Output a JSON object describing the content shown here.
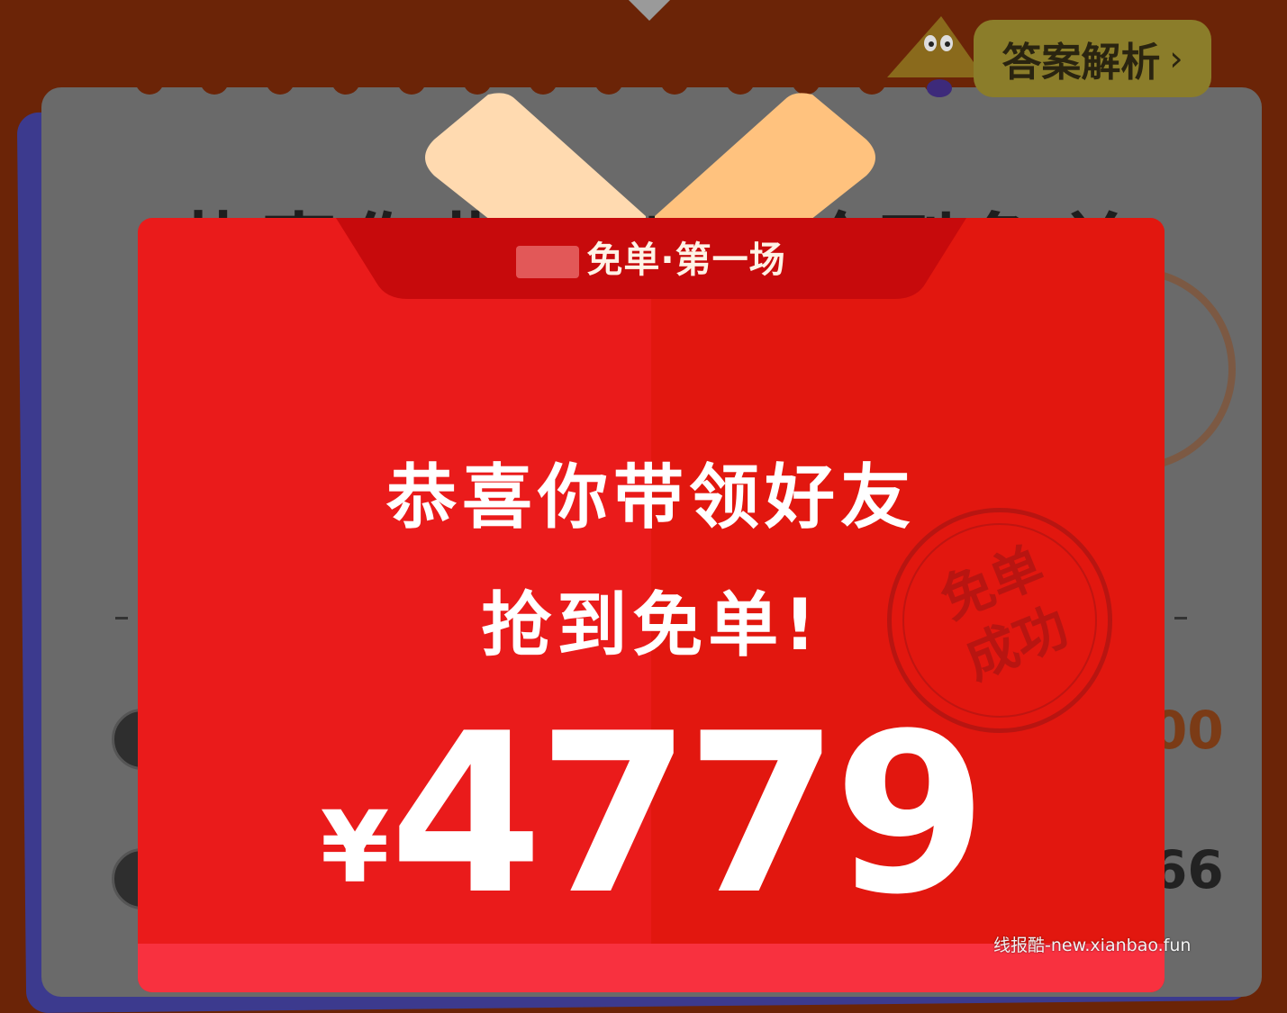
{
  "background": {
    "title": "恭喜你带领好友抢到免单",
    "row_values": [
      "00",
      "66"
    ]
  },
  "answer_button": {
    "label": "答案解析",
    "chevron": "›"
  },
  "modal": {
    "banner": "免单·第一场",
    "headline_line1": "恭喜你带领好友",
    "headline_line2": "抢到免单!",
    "currency": "¥",
    "amount": "4779",
    "stamp_line1": "免单",
    "stamp_line2": "成功"
  },
  "watermark": "线报酷-new.xianbao.fun",
  "colors": {
    "background": "#6b2407",
    "envelope_red": "#ea1b1b",
    "banner_red": "#c70a0c",
    "ribbon_light": "#ffd9a8",
    "ribbon_dark": "#ffc07a"
  }
}
